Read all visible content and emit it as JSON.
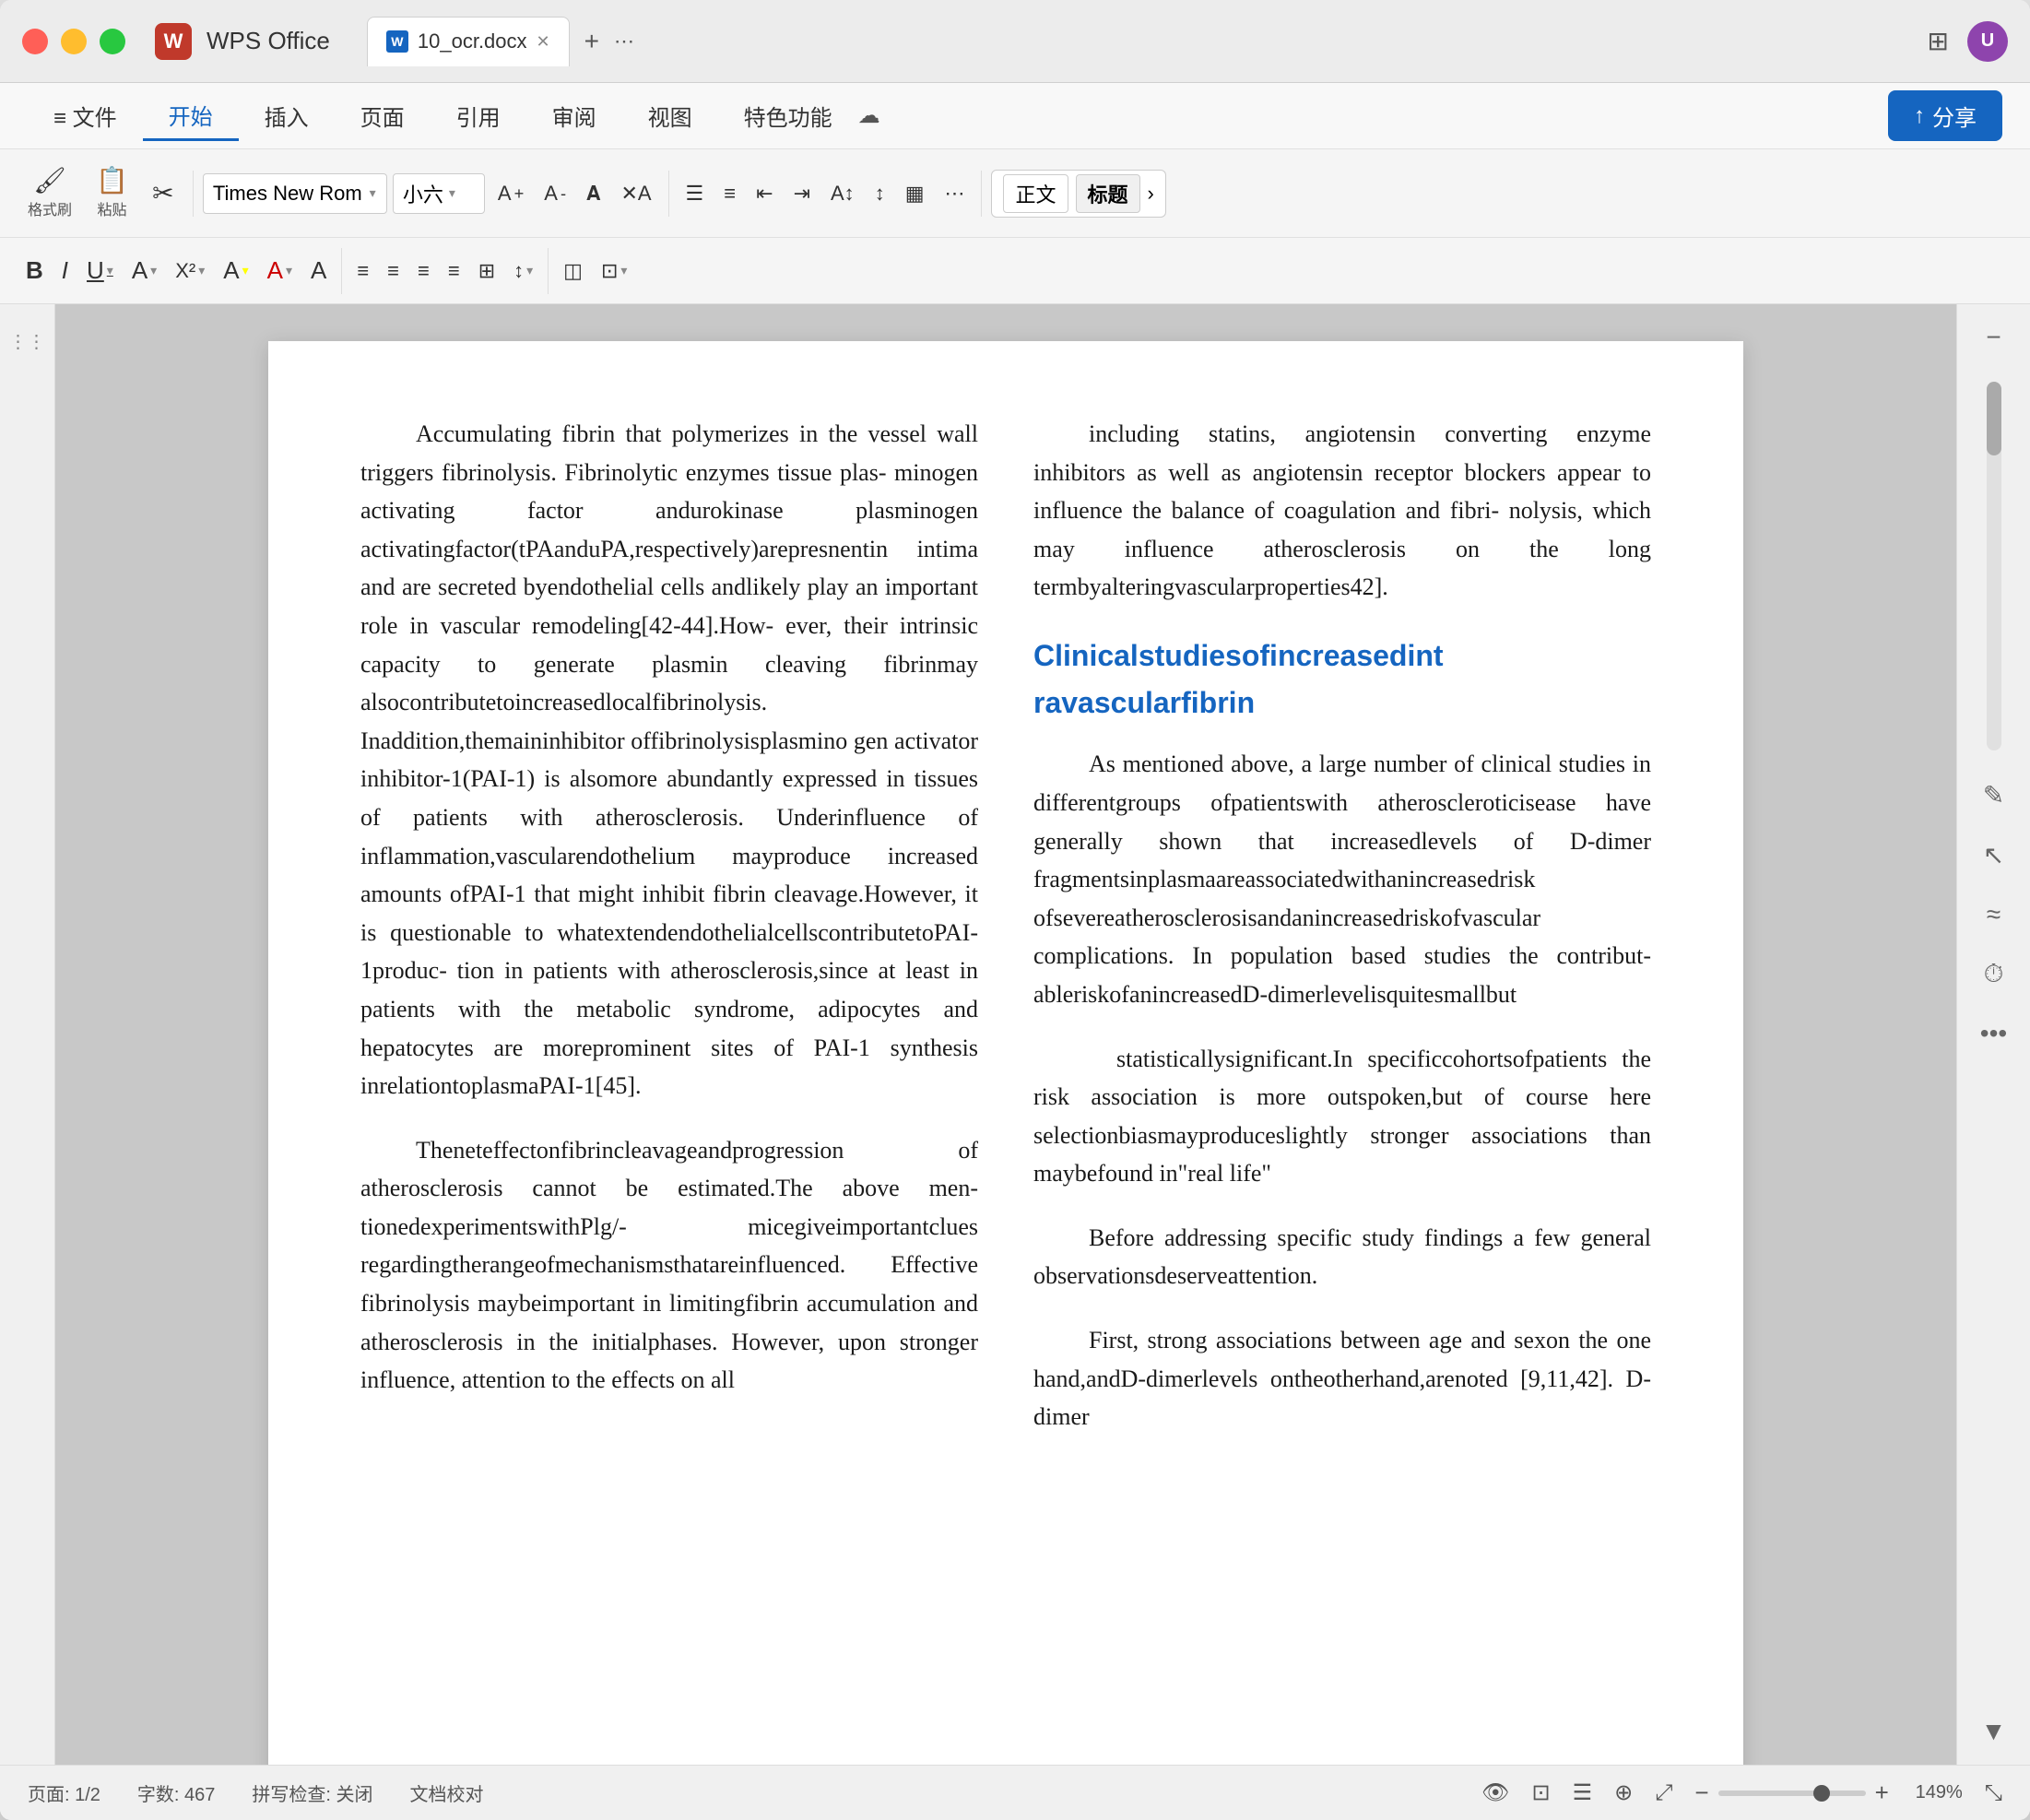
{
  "window": {
    "title": "WPS Office",
    "tab_name": "10_ocr.docx"
  },
  "titlebar": {
    "app_name": "WPS Office",
    "tab_label": "10_ocr.docx",
    "add_tab_label": "+",
    "traffic_lights": [
      "close",
      "minimize",
      "maximize"
    ]
  },
  "menubar": {
    "items": [
      "文件",
      "开始",
      "插入",
      "页面",
      "引用",
      "审阅",
      "视图",
      "特色功能"
    ],
    "active_item": "开始",
    "share_label": "分享",
    "cloud_label": "☁"
  },
  "toolbar": {
    "format_brush_label": "格式刷",
    "paste_label": "粘贴",
    "font_name": "Times New Rom",
    "font_size": "小六",
    "bold": "B",
    "italic": "I",
    "underline": "U",
    "style_normal": "正文",
    "style_heading": "标题"
  },
  "content": {
    "left_col": {
      "para1": "Accumulating fibrin that polymerizes in the vessel wall triggers fibrinolysis. Fibrinolytic enzymes tissue plas- minogen activating factor andurokinase plasminogen activating factor (tPA and uPA, respectively) are present in intima and are secreted by endothelial cells and likely play an important role in vascular remodeling[42-44]. How- ever, their intrinsic capacity to generate plasmin cleaving fibrin may also contribute to increased local fibrinolysis. In addition, the main inhibitor of fibrinolysis plasminogen activator inhibitor-1 (PAI-1) is also more abundantly expressed in tissues of patients with atherosclerosis. Under influence of inflammation, vascular endothelium may produce increased amounts of PAI-1 that might inhibit fibrin cleavage. However, it is questionable to what extended endothelial cells contribute to PAI-1 produc- tion in patients with atherosclerosis, since at least in patients with the metabolic syndrome, adipocytes and hepatocytes are more prominent sites of PAI-1 synthesis in relation to plasma PAI-1[45].",
      "para2": "The net effect on fibrin cleavage and progression of atherosclerosis cannot be estimated. The above men- tioned experiments with Plg/- mice give important clues regarding the range of mechanisms that are influenced. Effective fibrinolysis may be important in limiting fibrin accumulation and atherosclerosis in the initial phases. However, upon stronger influence, attention to the effects on all"
    },
    "right_col": {
      "para1": "including statins, angiotensin converting enzyme inhibitors as well as angiotensin receptor blockers appear to influence the balance of coagulation and fibri- nolysis, which may influence atherosclerosis on the long term by altering vascular properties 42].",
      "heading": "Clinical studies of increased intravascular fibrin",
      "para2": "As mentioned above, a large number of clinical studies in different groups of patients with atherosclerotic disease have generally shown that increased levels of D-dimer fragments in plasma are associated with an increased risk of severe atherosclerosis and an increased risk of vascular complications. In population based studies the contribut- able risk of an increased D-dimer level is quite small but",
      "para3": "statistically significant. In specific cohorts of patients the risk association is more outspoken, but of course here selection bias may produce slightly stronger associations than may be found in \"real life\"",
      "para4": "Before addressing specific study findings a few general observations deserve attention.",
      "para5": "First, strong associations between age and sex on the one hand, and D-dimer levels on the other hand, are noted [9,11,42]. D-dimer"
    }
  },
  "statusbar": {
    "page_info": "页面: 1/2",
    "word_count": "字数: 467",
    "spell_check": "拼写检查: 关闭",
    "doc_check": "文档校对",
    "zoom_level": "149%"
  }
}
